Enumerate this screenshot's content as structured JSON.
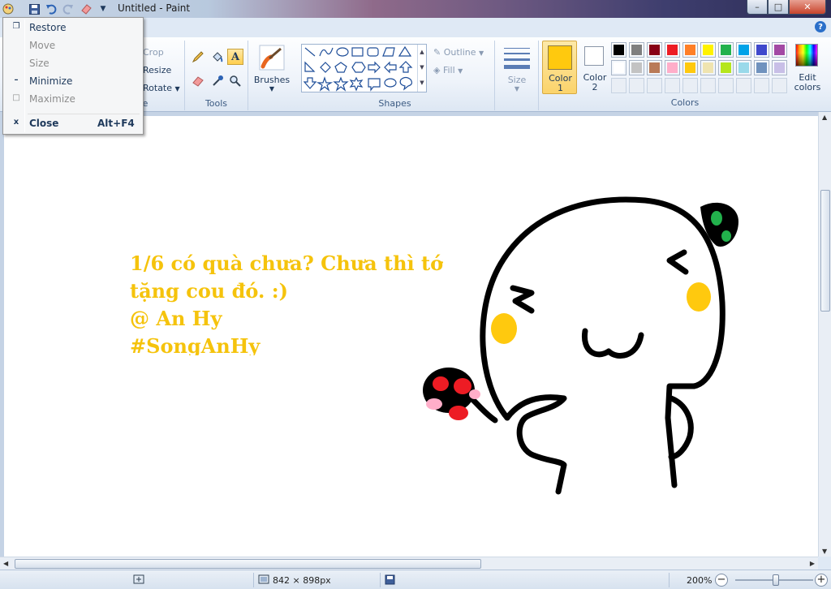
{
  "window": {
    "title": "Untitled - Paint"
  },
  "title_buttons": {
    "minimize": "–",
    "maximize": "□",
    "close": "✕"
  },
  "quick_access": [
    "paint-menu-icon",
    "save-icon",
    "undo-icon",
    "redo-icon",
    "eraser-icon",
    "customize-dropdown-icon"
  ],
  "ribbon": {
    "image_group": {
      "crop": "Crop",
      "resize": "Resize",
      "rotate": "Rotate",
      "label_fragment": "e"
    },
    "tools_group": {
      "label": "Tools",
      "text_tool": "A"
    },
    "brushes": {
      "label": "Brushes"
    },
    "shapes_group": {
      "label": "Shapes",
      "outline": "Outline",
      "fill": "Fill"
    },
    "size": {
      "label": "Size"
    },
    "color1": {
      "label_line1": "Color",
      "label_line2": "1",
      "color": "#ffc90e"
    },
    "color2": {
      "label_line1": "Color",
      "label_line2": "2",
      "color": "#ffffff"
    },
    "colors_group": {
      "label": "Colors"
    },
    "edit_colors": {
      "label_line1": "Edit",
      "label_line2": "colors"
    },
    "palette_row1": [
      "#000000",
      "#7f7f7f",
      "#880015",
      "#ed1c24",
      "#ff7f27",
      "#fff200",
      "#22b14c",
      "#00a2e8",
      "#3f48cc",
      "#a349a4"
    ],
    "palette_row2": [
      "#ffffff",
      "#c3c3c3",
      "#b97a57",
      "#ffaec9",
      "#ffc90e",
      "#efe4b0",
      "#b5e61d",
      "#99d9ea",
      "#7092be",
      "#c8bfe7"
    ],
    "palette_row3": [
      "",
      "",
      "",
      "",
      "",
      "",
      "",
      "",
      "",
      ""
    ]
  },
  "canvas": {
    "text_lines": [
      "1/6 có quà chưa? Chưa thì tớ",
      "tặng cou đó. :)",
      "@ An Hy",
      "#SongAnHy"
    ],
    "text_color": "#f5c30c"
  },
  "system_menu": {
    "restore": "Restore",
    "move": "Move",
    "size": "Size",
    "minimize": "Minimize",
    "maximize": "Maximize",
    "close": "Close",
    "close_shortcut": "Alt+F4"
  },
  "status": {
    "image_size": "842 × 898px",
    "zoom": "200%"
  }
}
